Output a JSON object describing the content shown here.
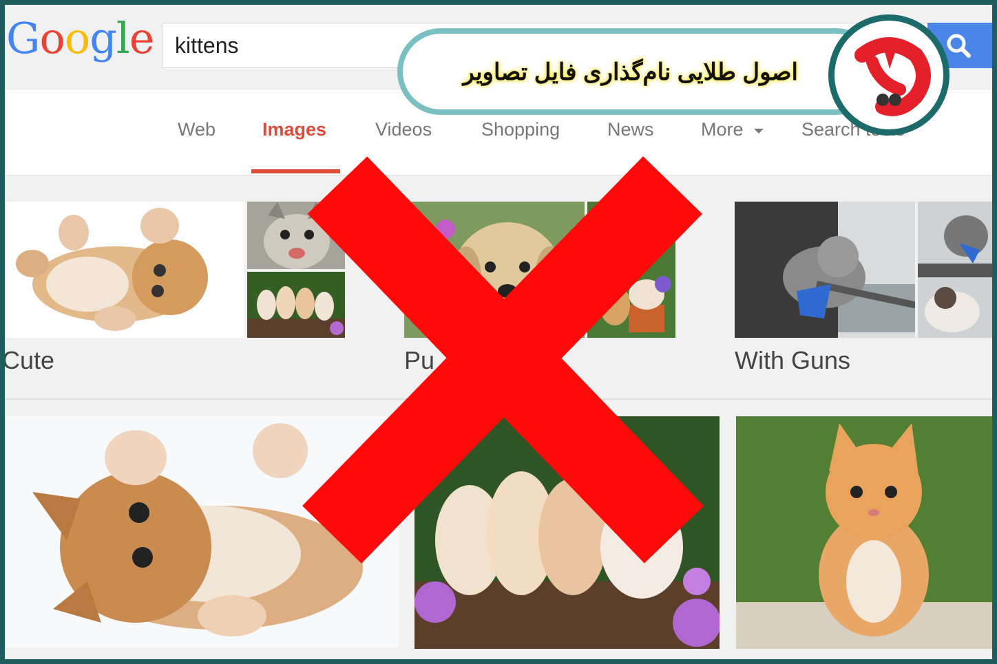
{
  "google": {
    "logo_text": "Google",
    "search_query": "kittens"
  },
  "tabs": [
    {
      "label": "Web"
    },
    {
      "label": "Images"
    },
    {
      "label": "Videos"
    },
    {
      "label": "Shopping"
    },
    {
      "label": "News"
    },
    {
      "label": "More"
    },
    {
      "label": "Search tools"
    }
  ],
  "active_tab": "Images",
  "categories": [
    {
      "label": "Cute"
    },
    {
      "label": "Pu"
    },
    {
      "label": "With Guns"
    }
  ],
  "banner": {
    "title": "اصول طلایی نام‌گذاری فایل تصاویر"
  },
  "colors": {
    "frame": "#1f5e5e",
    "accent_red": "#dd4b39",
    "banner_border": "#7abfc1",
    "cross": "#ff0a0a",
    "search_button": "#4a86e8"
  },
  "icons": {
    "search": "search-icon",
    "more_caret": "caret-down-icon",
    "brand": "brand-logo-icon",
    "cross": "red-x-icon"
  }
}
